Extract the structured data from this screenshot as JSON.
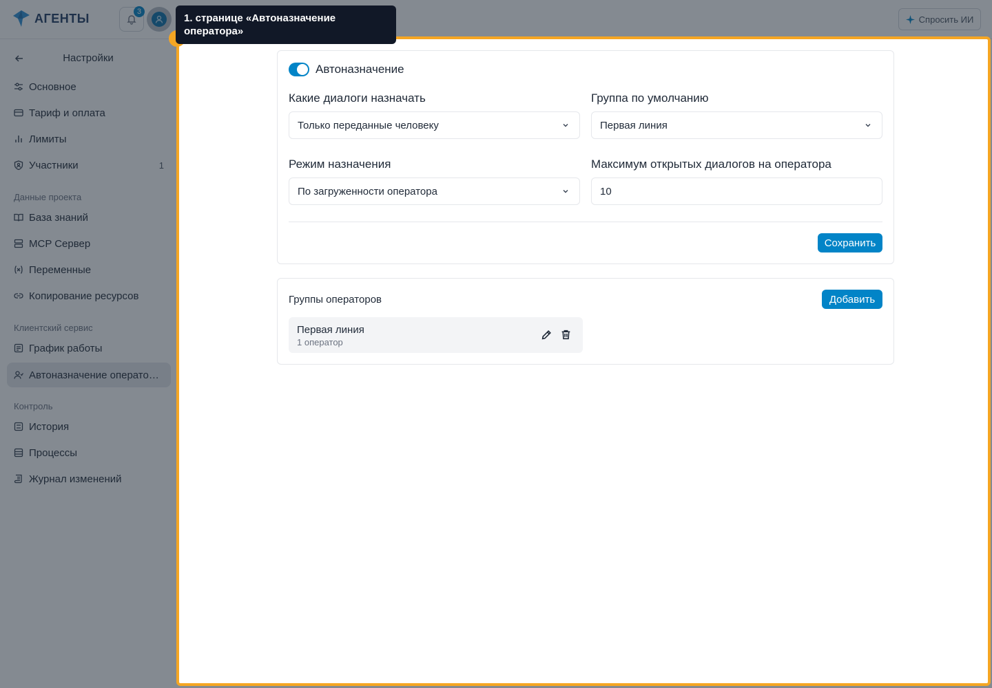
{
  "app": {
    "logo_text": "АГЕНТЫ",
    "notifications_count": "3",
    "ask_ai_label": "Спросить ИИ"
  },
  "sidebar": {
    "title": "Настройки",
    "items_main": [
      {
        "label": "Основное",
        "icon": "sliders-icon"
      },
      {
        "label": "Тариф и оплата",
        "icon": "credit-card-icon"
      },
      {
        "label": "Лимиты",
        "icon": "bar-chart-icon"
      },
      {
        "label": "Участники",
        "icon": "shield-user-icon",
        "count": "1"
      }
    ],
    "section_project": "Данные проекта",
    "items_project": [
      {
        "label": "База знаний",
        "icon": "book-icon"
      },
      {
        "label": "MCP Сервер",
        "icon": "server-icon"
      },
      {
        "label": "Переменные",
        "icon": "variable-icon"
      },
      {
        "label": "Копирование ресурсов",
        "icon": "link-icon"
      }
    ],
    "section_client": "Клиентский сервис",
    "items_client": [
      {
        "label": "График работы",
        "icon": "calendar-icon"
      },
      {
        "label": "Автоназначение операторов",
        "icon": "user-assign-icon",
        "active": true
      }
    ],
    "section_control": "Контроль",
    "items_control": [
      {
        "label": "История",
        "icon": "list-icon"
      },
      {
        "label": "Процессы",
        "icon": "database-icon"
      },
      {
        "label": "Журнал изменений",
        "icon": "scroll-icon"
      }
    ]
  },
  "tour": {
    "tooltip_text": "1. странице «Автоназначение оператора»"
  },
  "settings": {
    "autoassign_label": "Автоназначение",
    "autoassign_enabled": true,
    "dialogs_label": "Какие диалоги назначать",
    "dialogs_value": "Только переданные человеку",
    "default_group_label": "Группа по умолчанию",
    "default_group_value": "Первая линия",
    "mode_label": "Режим назначения",
    "mode_value": "По загруженности оператора",
    "max_dialogs_label": "Максимум открытых диалогов на оператора",
    "max_dialogs_value": "10",
    "save_label": "Сохранить"
  },
  "groups": {
    "title": "Группы операторов",
    "add_label": "Добавить",
    "items": [
      {
        "name": "Первая линия",
        "subtitle": "1 оператор"
      }
    ]
  },
  "colors": {
    "accent": "#0284c7",
    "highlight": "#f5a623",
    "tooltip_bg": "#111827"
  }
}
